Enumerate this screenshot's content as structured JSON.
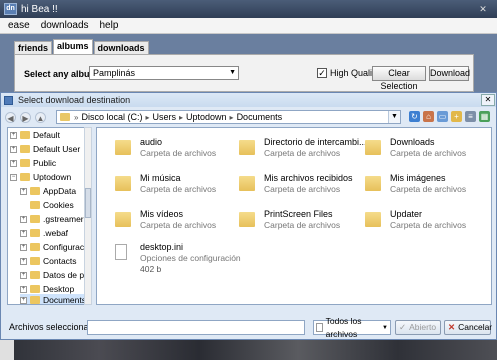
{
  "app": {
    "title": "hi Bea !!",
    "logo": "dn",
    "menu": [
      "ease",
      "downloads",
      "help"
    ],
    "tabs": [
      "friends",
      "albums",
      "downloads"
    ],
    "active_tab": "albums",
    "album_label": "Select any album",
    "album_value": "Pamplinás",
    "hq_label": "High Quality",
    "hq_checked": true,
    "clear_button": "Clear Selection",
    "download_button": "Download"
  },
  "dialog": {
    "title": "Select download destination",
    "breadcrumb": [
      "Disco local (C:)",
      "Users",
      "Uptodown",
      "Documents"
    ],
    "tree": [
      {
        "label": "Default",
        "level": 1,
        "expander": "+"
      },
      {
        "label": "Default User",
        "level": 1,
        "expander": "+"
      },
      {
        "label": "Public",
        "level": 1,
        "expander": "+"
      },
      {
        "label": "Uptodown",
        "level": 1,
        "expander": "-"
      },
      {
        "label": "AppData",
        "level": 2,
        "expander": "+"
      },
      {
        "label": "Cookies",
        "level": 2,
        "expander": ""
      },
      {
        "label": ".gstreamer-C",
        "level": 2,
        "expander": "+"
      },
      {
        "label": ".webaf",
        "level": 2,
        "expander": "+"
      },
      {
        "label": "Configuració",
        "level": 2,
        "expander": "+"
      },
      {
        "label": "Contacts",
        "level": 2,
        "expander": "+"
      },
      {
        "label": "Datos de pro",
        "level": 2,
        "expander": "+"
      },
      {
        "label": "Desktop",
        "level": 2,
        "expander": "+"
      },
      {
        "label": "Documents",
        "level": 2,
        "expander": "+",
        "selected": true
      }
    ],
    "files": [
      {
        "name": "audio",
        "type": "Carpeta de archivos",
        "kind": "folder"
      },
      {
        "name": "Directorio de intercambi...",
        "type": "Carpeta de archivos",
        "kind": "folder"
      },
      {
        "name": "Downloads",
        "type": "Carpeta de archivos",
        "kind": "folder"
      },
      {
        "name": "Mi música",
        "type": "Carpeta de archivos",
        "kind": "folder"
      },
      {
        "name": "Mis archivos recibidos",
        "type": "Carpeta de archivos",
        "kind": "folder"
      },
      {
        "name": "Mis imágenes",
        "type": "Carpeta de archivos",
        "kind": "folder"
      },
      {
        "name": "Mis vídeos",
        "type": "Carpeta de archivos",
        "kind": "folder"
      },
      {
        "name": "PrintScreen Files",
        "type": "Carpeta de archivos",
        "kind": "folder"
      },
      {
        "name": "Updater",
        "type": "Carpeta de archivos",
        "kind": "folder"
      },
      {
        "name": "desktop.ini",
        "type": "Opciones de configuración",
        "size": "402 b",
        "kind": "file"
      }
    ],
    "selected_label": "Archivos seleccionados:",
    "selected_value": "",
    "filter": "Todos los archivos",
    "open_button": "Abierto",
    "cancel_button": "Cancelar"
  }
}
